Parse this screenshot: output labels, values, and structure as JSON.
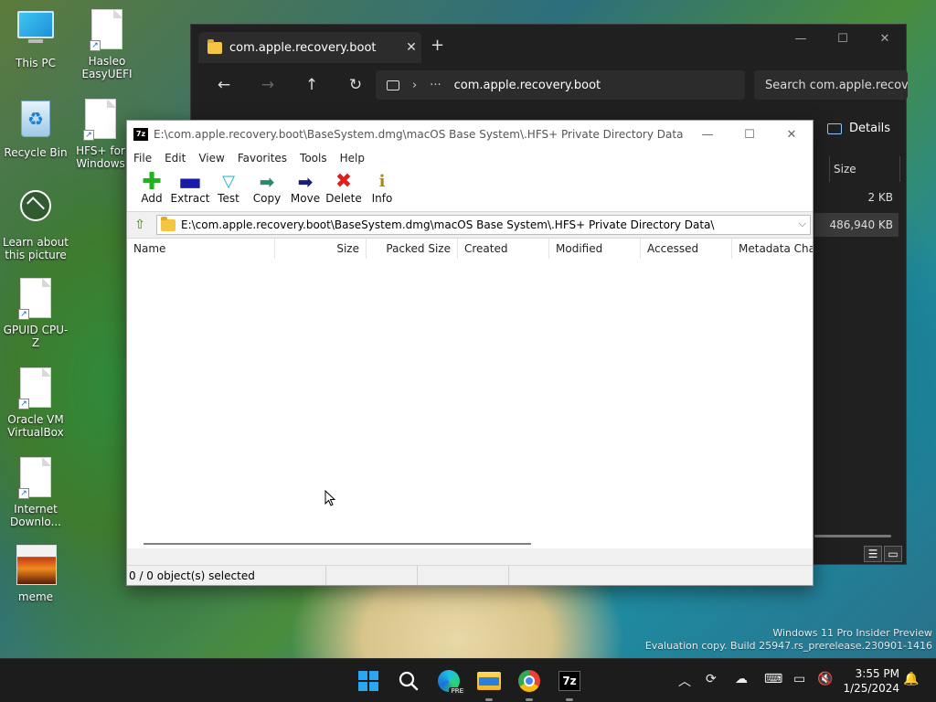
{
  "desktop": {
    "icons": [
      {
        "label": "This PC"
      },
      {
        "label": "Hasleo EasyUEFI"
      },
      {
        "label": "Recycle Bin"
      },
      {
        "label": "HFS+ for Windows"
      },
      {
        "label": "Learn about this picture"
      },
      {
        "label": "GPUID CPU-Z"
      },
      {
        "label": "Oracle VM VirtualBox"
      },
      {
        "label": "Internet Downlo..."
      },
      {
        "label": "meme"
      }
    ]
  },
  "explorer": {
    "tab_title": "com.apple.recovery.boot",
    "address": "com.apple.recovery.boot",
    "search_placeholder": "Search com.apple.recove",
    "details_label": "Details",
    "size_header": "Size",
    "rows": [
      {
        "size": "2 KB"
      },
      {
        "size": "486,940 KB"
      }
    ]
  },
  "sevenzip": {
    "logo": "7z",
    "title": "E:\\com.apple.recovery.boot\\BaseSystem.dmg\\macOS Base System\\.HFS+ Private Directory Data",
    "menu": [
      "File",
      "Edit",
      "View",
      "Favorites",
      "Tools",
      "Help"
    ],
    "toolbar": [
      {
        "label": "Add",
        "icon": "plus-icon"
      },
      {
        "label": "Extract",
        "icon": "minus-icon"
      },
      {
        "label": "Test",
        "icon": "check-icon"
      },
      {
        "label": "Copy",
        "icon": "arrow-right-icon"
      },
      {
        "label": "Move",
        "icon": "arrow-right-icon"
      },
      {
        "label": "Delete",
        "icon": "x-icon"
      },
      {
        "label": "Info",
        "icon": "info-icon"
      }
    ],
    "path": "E:\\com.apple.recovery.boot\\BaseSystem.dmg\\macOS Base System\\.HFS+ Private Directory Data\\",
    "columns": [
      "Name",
      "Size",
      "Packed Size",
      "Created",
      "Modified",
      "Accessed",
      "Metadata Cha..."
    ],
    "status": "0 / 0 object(s) selected"
  },
  "watermark": {
    "line1": "Windows 11 Pro Insider Preview",
    "line2": "Evaluation copy. Build 25947.rs_prerelease.230901-1416"
  },
  "taskbar": {
    "time": "3:55 PM",
    "date": "1/25/2024",
    "sevenzip_label": "7z",
    "edge_badge": "PRE"
  }
}
